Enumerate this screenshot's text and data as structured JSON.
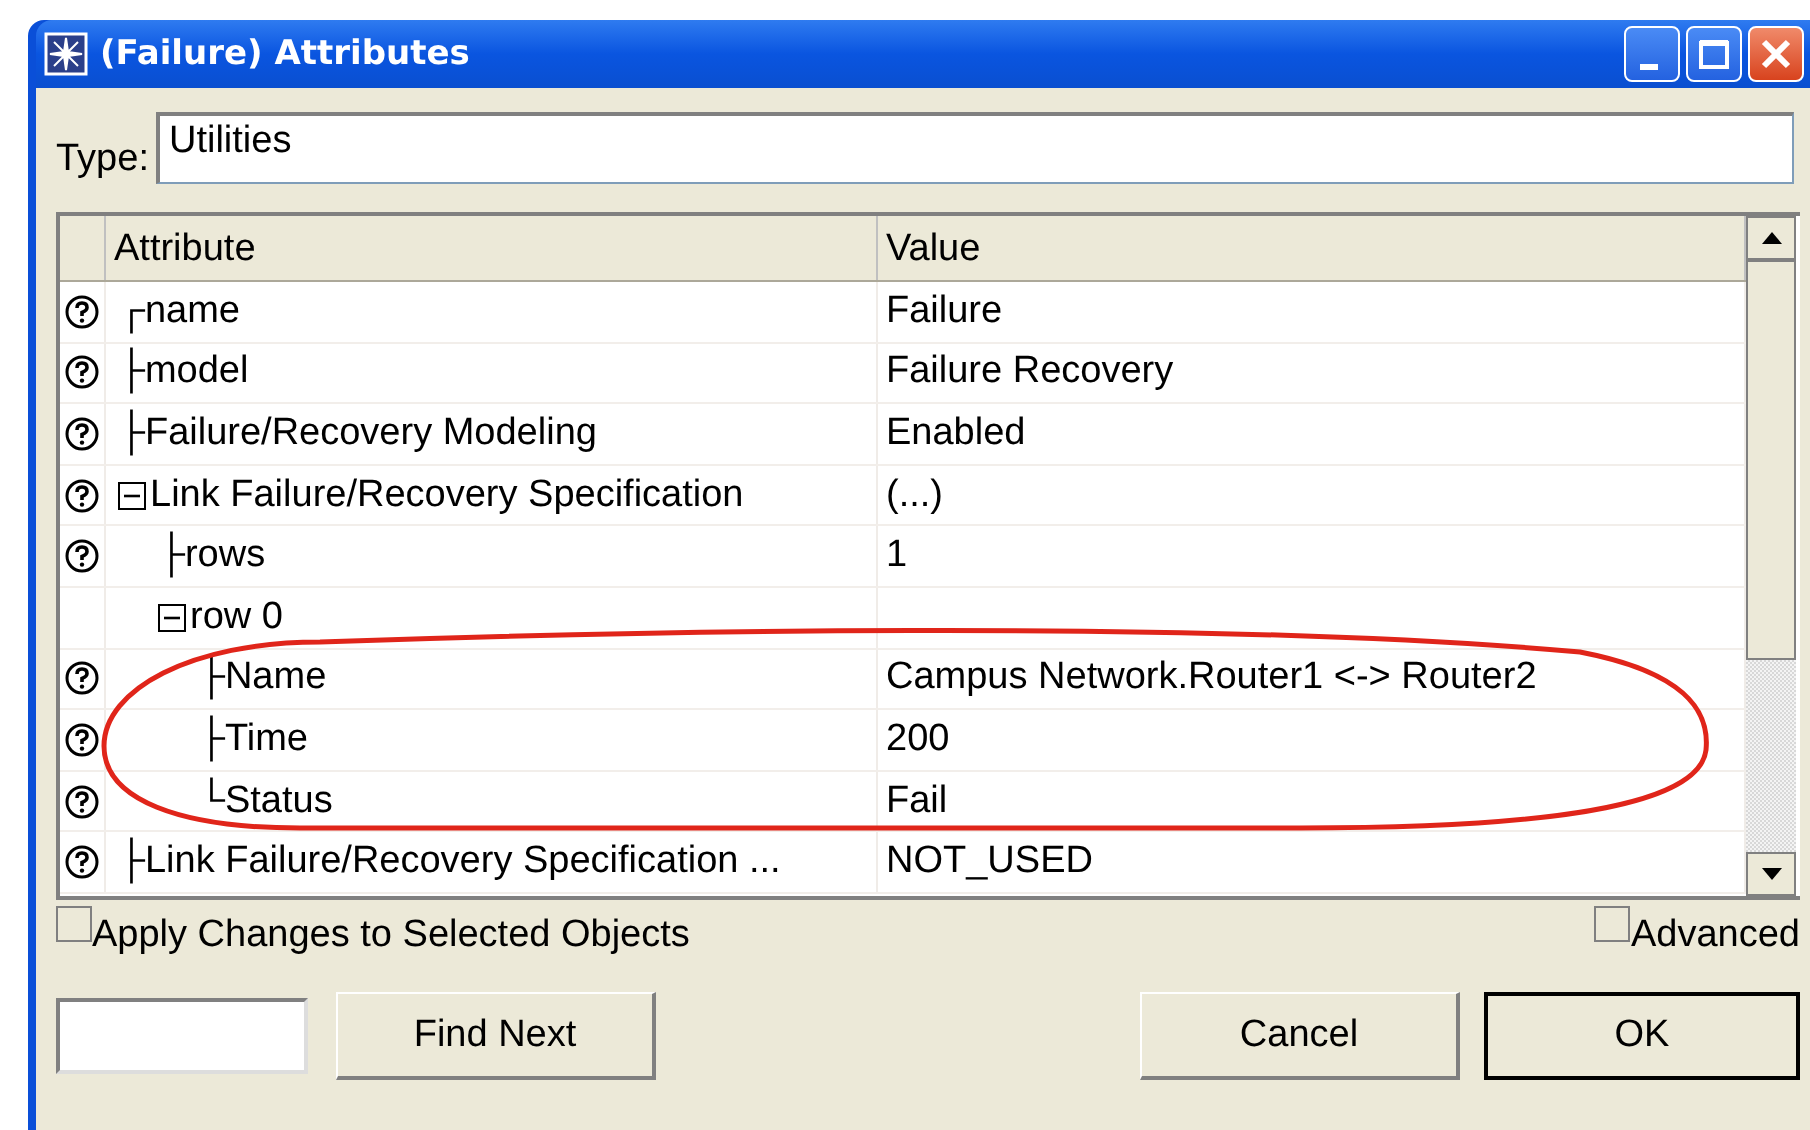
{
  "window": {
    "title": "(Failure) Attributes"
  },
  "type": {
    "label": "Type:",
    "value": "Utilities"
  },
  "table": {
    "columns": [
      "Attribute",
      "Value"
    ],
    "rows": [
      {
        "connector": "┌",
        "name": "name",
        "value": "Failure",
        "help": true
      },
      {
        "connector": "├",
        "name": "model",
        "value": "Failure Recovery",
        "help": true
      },
      {
        "connector": "├",
        "name": "Failure/Recovery Modeling",
        "value": "Enabled",
        "help": true
      },
      {
        "name": "Link Failure/Recovery Specification",
        "value": "(...)",
        "help": true,
        "expanded": true,
        "children": [
          {
            "connector": "├",
            "name": "rows",
            "value": "1",
            "help": true
          },
          {
            "name": "row 0",
            "help": false,
            "expanded": true,
            "children": [
              {
                "connector": "├",
                "name": "Name",
                "value": "Campus Network.Router1 <-> Router2",
                "help": true
              },
              {
                "connector": "├",
                "name": "Time",
                "value": "200",
                "help": true
              },
              {
                "connector": "└",
                "name": "Status",
                "value": "Fail",
                "help": true
              }
            ]
          }
        ]
      },
      {
        "connector": "├",
        "name": "Link Failure/Recovery Specification ...",
        "value": "NOT_USED",
        "help": true
      }
    ]
  },
  "options": [
    {
      "label": "Apply Changes to Selected Objects",
      "checked": false
    },
    {
      "label": "Advanced",
      "checked": false
    }
  ],
  "buttons": [
    {
      "label": "Find Next",
      "kind": "find"
    },
    {
      "label": "Cancel",
      "kind": "cancel"
    },
    {
      "label": "OK",
      "kind": "ok"
    }
  ]
}
